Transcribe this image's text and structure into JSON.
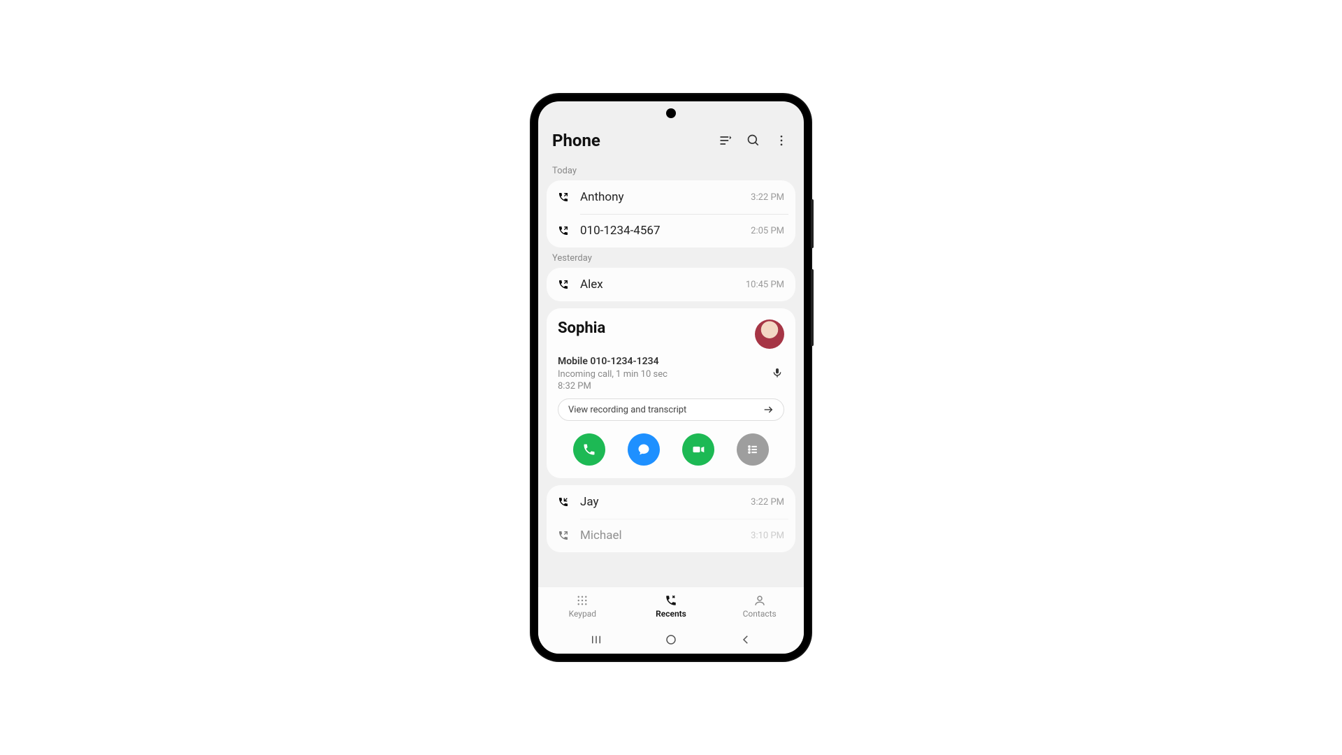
{
  "header": {
    "title": "Phone"
  },
  "sections": {
    "today_label": "Today",
    "yesterday_label": "Yesterday"
  },
  "calls_today": [
    {
      "name": "Anthony",
      "time": "3:22 PM",
      "dir": "out"
    },
    {
      "name": "010-1234-4567",
      "time": "2:05 PM",
      "dir": "out"
    }
  ],
  "calls_yesterday": [
    {
      "name": "Alex",
      "time": "10:45 PM",
      "dir": "out"
    }
  ],
  "expanded": {
    "name": "Sophia",
    "number_label": "Mobile 010-1234-1234",
    "detail": "Incoming call, 1 min 10 sec",
    "time": "8:32 PM",
    "pill": "View recording and transcript"
  },
  "calls_after": [
    {
      "name": "Jay",
      "time": "3:22 PM",
      "dir": "in"
    },
    {
      "name": "Michael",
      "time": "3:10 PM",
      "dir": "out"
    }
  ],
  "nav": {
    "keypad": "Keypad",
    "recents": "Recents",
    "contacts": "Contacts"
  }
}
